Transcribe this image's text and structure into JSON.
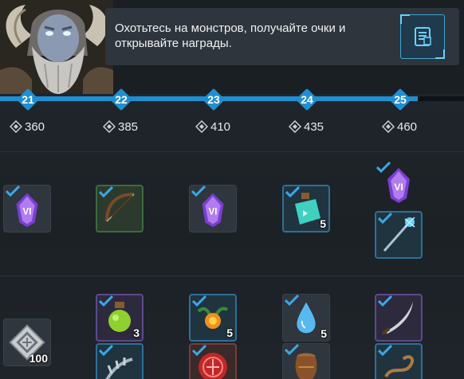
{
  "banner": {
    "tip": "Охотьтесь на монстров, получайте очки и открывайте награды."
  },
  "track": {
    "progress_fraction": 0.9,
    "levels": [
      {
        "level": "21",
        "points": "360"
      },
      {
        "level": "22",
        "points": "385"
      },
      {
        "level": "23",
        "points": "410"
      },
      {
        "level": "24",
        "points": "435"
      },
      {
        "level": "25",
        "points": "460"
      }
    ]
  },
  "rewards": {
    "row1": [
      {
        "item": "purple-crystal",
        "claimed": true,
        "qty": ""
      },
      {
        "item": "bow",
        "claimed": true,
        "qty": ""
      },
      {
        "item": "purple-crystal",
        "claimed": true,
        "qty": ""
      },
      {
        "item": "blue-potion",
        "claimed": true,
        "qty": "5"
      },
      {
        "item": "purple-crystal",
        "claimed": true,
        "qty": ""
      },
      {
        "item": "ice-staff",
        "claimed": true,
        "qty": ""
      }
    ],
    "row2": [
      {
        "item": "silver-token",
        "claimed": false,
        "qty": "100"
      },
      {
        "item": "green-potion",
        "claimed": true,
        "qty": "3"
      },
      {
        "item": "fire-flower",
        "claimed": true,
        "qty": "5"
      },
      {
        "item": "water-drop",
        "claimed": true,
        "qty": "5"
      },
      {
        "item": "curved-blade",
        "claimed": true,
        "qty": ""
      },
      {
        "item": "claw",
        "claimed": true,
        "qty": ""
      },
      {
        "item": "red-seal",
        "claimed": true,
        "qty": ""
      },
      {
        "item": "clay-pot",
        "claimed": true,
        "qty": ""
      },
      {
        "item": "rope-whip",
        "claimed": true,
        "qty": ""
      }
    ]
  },
  "colors": {
    "accent": "#1f8fd1",
    "check": "#3aa8e8",
    "panel": "#2e353c"
  },
  "icons": {
    "points": "rune-diamond-icon",
    "info": "journal-icon",
    "claimed": "checkmark-icon"
  }
}
